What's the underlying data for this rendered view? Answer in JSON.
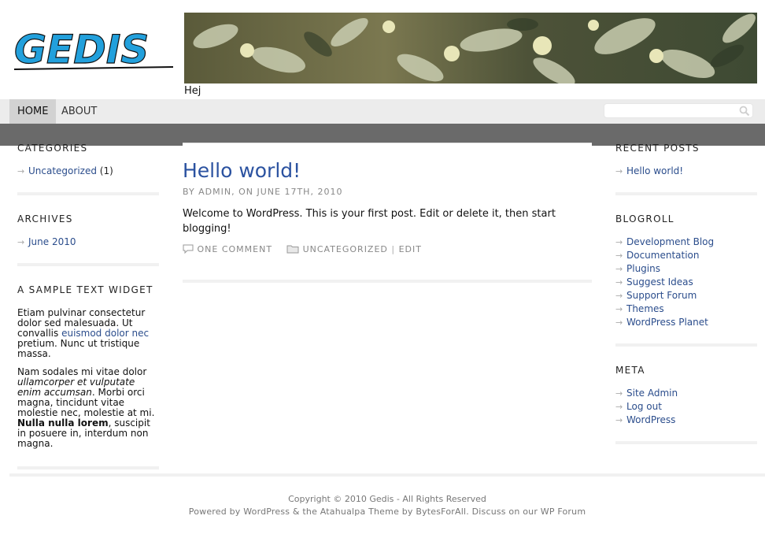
{
  "header": {
    "logo_text": "GEDIS",
    "tagline": "Hej"
  },
  "menu": {
    "items": [
      {
        "label": "HOME"
      },
      {
        "label": "ABOUT"
      }
    ]
  },
  "left_sidebar": {
    "categories": {
      "title": "CATEGORIES",
      "items": [
        {
          "label": "Uncategorized",
          "count": "(1)"
        }
      ]
    },
    "archives": {
      "title": "ARCHIVES",
      "items": [
        {
          "label": "June 2010"
        }
      ]
    },
    "text_widget": {
      "title": "A SAMPLE TEXT WIDGET",
      "p1_a": "Etiam pulvinar consectetur dolor sed malesuada. Ut convallis ",
      "p1_link": "euismod dolor nec",
      "p1_b": " pretium. Nunc ut tristique massa.",
      "p2_a": "Nam sodales mi vitae dolor ",
      "p2_italic": "ullamcorper et vulputate enim accumsan",
      "p2_b": ". Morbi orci magna, tincidunt vitae molestie nec, molestie at mi. ",
      "p2_bold": "Nulla nulla lorem",
      "p2_c": ", suscipit in posuere in, interdum non magna."
    }
  },
  "post": {
    "title": "Hello world!",
    "meta": "BY ADMIN, ON JUNE 17TH, 2010",
    "body": "Welcome to WordPress. This is your first post. Edit or delete it, then start blogging!",
    "comments": "ONE COMMENT",
    "category": "UNCATEGORIZED",
    "divider": "|",
    "edit": "EDIT"
  },
  "right_sidebar": {
    "recent_posts": {
      "title": "RECENT POSTS",
      "items": [
        {
          "label": "Hello world!"
        }
      ]
    },
    "blogroll": {
      "title": "BLOGROLL",
      "items": [
        {
          "label": "Development Blog"
        },
        {
          "label": "Documentation"
        },
        {
          "label": "Plugins"
        },
        {
          "label": "Suggest Ideas"
        },
        {
          "label": "Support Forum"
        },
        {
          "label": "Themes"
        },
        {
          "label": "WordPress Planet"
        }
      ]
    },
    "meta": {
      "title": "META",
      "items": [
        {
          "label": "Site Admin"
        },
        {
          "label": "Log out"
        },
        {
          "label": "WordPress"
        }
      ]
    }
  },
  "footer": {
    "copyright": "Copyright © 2010 Gedis - All Rights Reserved",
    "powered": "Powered by WordPress & the Atahualpa Theme by BytesForAll. Discuss on our WP Forum"
  },
  "colors": {
    "link": "#2b4d8c",
    "logo": "#22a0dc",
    "menubar": "#ececec",
    "darkbar": "#6a6a6a"
  }
}
